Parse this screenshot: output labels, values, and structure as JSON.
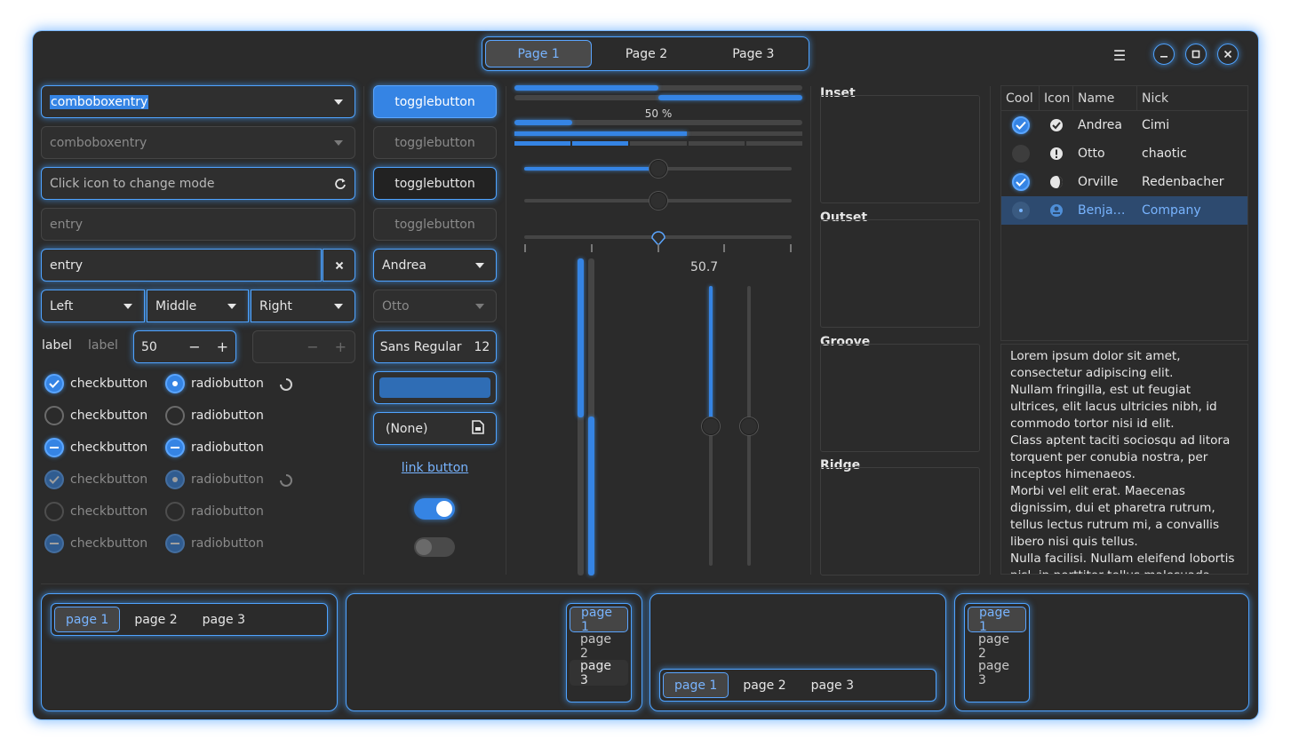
{
  "header": {
    "pages": [
      "Page 1",
      "Page 2",
      "Page 3"
    ],
    "active_page": 0,
    "menu_icon": "hamburger-icon",
    "window_controls": [
      "minimize-icon",
      "maximize-icon",
      "close-icon"
    ]
  },
  "col1": {
    "combo1": "comboboxentry",
    "combo2_placeholder": "comboboxentry",
    "entry_mode": "Click icon to change mode",
    "entry_placeholder": "entry",
    "entry_value": "entry",
    "combos": [
      "Left",
      "Middle",
      "Right"
    ],
    "label1": "label",
    "label2": "label",
    "spin_value": "50",
    "spin_minus": "−",
    "spin_plus": "+",
    "checkbutton": "checkbutton",
    "radiobutton": "radiobutton"
  },
  "col2": {
    "toggle": "togglebutton",
    "combo_andrea": "Andrea",
    "combo_otto": "Otto",
    "font_name": "Sans Regular",
    "font_size": "12",
    "file_none": "(None)",
    "link": "link button",
    "switch_on": true,
    "switch_off": false
  },
  "col3": {
    "progress_top": 0.5,
    "progress_label": "50 %",
    "progress_small": 0.2,
    "progress_mid": 0.6,
    "level_segments": [
      1,
      1,
      0,
      0,
      0
    ],
    "scale_values": [
      0.5,
      0.5,
      0.5
    ],
    "vertical_scale_value": "50.7",
    "accent": "#3584e4"
  },
  "frames": [
    "Inset",
    "Outset",
    "Groove",
    "Ridge"
  ],
  "tree": {
    "columns": [
      "Cool",
      "Icon",
      "Name",
      "Nick"
    ],
    "rows": [
      {
        "cool": "on",
        "icon": "check-circle-icon",
        "name": "Andrea",
        "nick": "Cimi"
      },
      {
        "cool": "off",
        "icon": "exclamation-circle-icon",
        "name": "Otto",
        "nick": "chaotic"
      },
      {
        "cool": "on",
        "icon": "half-moon-icon",
        "name": "Orville",
        "nick": "Redenbacher"
      },
      {
        "cool": "inconsistent",
        "icon": "person-icon",
        "name": "Benja…",
        "nick": "Company"
      }
    ]
  },
  "textview": {
    "text": "Lorem ipsum dolor sit amet, consectetur adipiscing elit.\nNullam fringilla, est ut feugiat ultrices, elit lacus ultricies nibh, id commodo tortor nisi id elit.\nClass aptent taciti sociosqu ad litora torquent per conubia nostra, per inceptos himenaeos.\nMorbi vel elit erat. Maecenas dignissim, dui et pharetra rutrum, tellus lectus rutrum mi, a convallis libero nisi quis tellus.\nNulla facilisi. Nullam eleifend lobortis nisl, in porttitor tellus malesuada vitae."
  },
  "notebooks": {
    "tabs": [
      "page 1",
      "page 2",
      "page 3"
    ]
  }
}
